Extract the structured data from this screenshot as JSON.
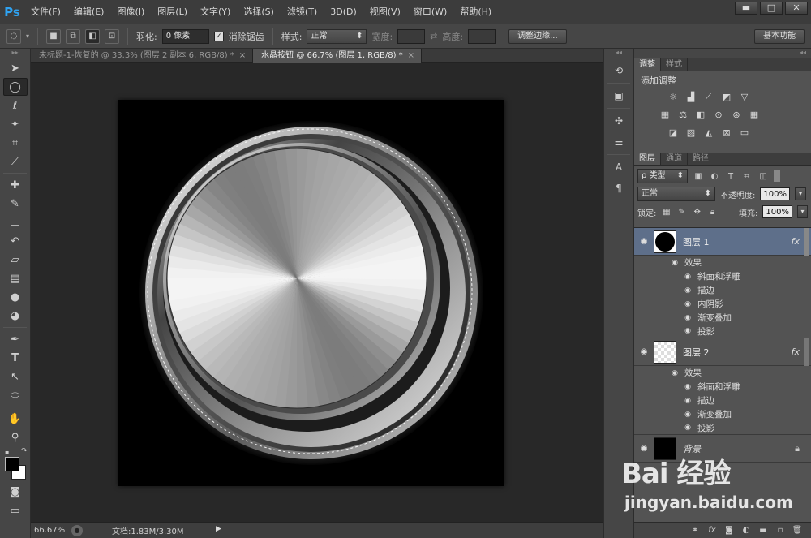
{
  "app": {
    "logo": "Ps"
  },
  "menu": [
    "文件(F)",
    "编辑(E)",
    "图像(I)",
    "图层(L)",
    "文字(Y)",
    "选择(S)",
    "滤镜(T)",
    "3D(D)",
    "视图(V)",
    "窗口(W)",
    "帮助(H)"
  ],
  "window_controls": {
    "minimize": "▬",
    "maximize": "□",
    "close": "✕"
  },
  "options": {
    "feather_label": "羽化:",
    "feather_value": "0 像素",
    "antialias_label": "消除锯齿",
    "antialias_checked": "✓",
    "style_label": "样式:",
    "style_value": "正常",
    "width_label": "宽度:",
    "height_label": "高度:",
    "refine_edge": "调整边缘...",
    "workspace": "基本功能"
  },
  "tabs": [
    {
      "label": "未标题-1-恢复的 @ 33.3% (图层 2 副本 6, RGB/8) *",
      "close": "×",
      "active": false
    },
    {
      "label": "水晶按钮 @ 66.7% (图层 1, RGB/8) *",
      "close": "×",
      "active": true
    }
  ],
  "status": {
    "zoom": "66.67%",
    "doc_info": "文档:1.83M/3.30M",
    "arrow": "▶"
  },
  "adjustments": {
    "tabs": [
      "调整",
      "样式"
    ],
    "title": "添加调整",
    "rows": [
      [
        "sun-icon",
        "levels-icon",
        "curves-icon",
        "exposure-icon",
        "triangle-icon"
      ],
      [
        "hsl-icon",
        "balance-icon",
        "bw-icon",
        "photo-filter-icon",
        "channel-mixer-icon",
        "grid-icon"
      ],
      [
        "invert-icon",
        "posterize-icon",
        "threshold-icon",
        "selective-color-icon",
        "gradient-map-icon"
      ]
    ]
  },
  "layers": {
    "tabs": [
      "图层",
      "通道",
      "路径"
    ],
    "filter_label": "ρ 类型",
    "blend_mode": "正常",
    "opacity_label": "不透明度:",
    "opacity_value": "100%",
    "lock_label": "锁定:",
    "fill_label": "填充:",
    "fill_value": "100%",
    "items": [
      {
        "name": "图层 1",
        "thumb": "black-circle",
        "selected": true,
        "fx": "fx",
        "effects_label": "效果",
        "effects": [
          "斜面和浮雕",
          "描边",
          "内阴影",
          "渐变叠加",
          "投影"
        ]
      },
      {
        "name": "图层 2",
        "thumb": "checker",
        "selected": false,
        "fx": "fx",
        "effects_label": "效果",
        "effects": [
          "斜面和浮雕",
          "描边",
          "渐变叠加",
          "投影"
        ]
      },
      {
        "name": "背景",
        "thumb": "black",
        "selected": false,
        "locked": true
      }
    ]
  },
  "watermark": {
    "logo": "Bai 经验",
    "url": "jingyan.baidu.com"
  }
}
